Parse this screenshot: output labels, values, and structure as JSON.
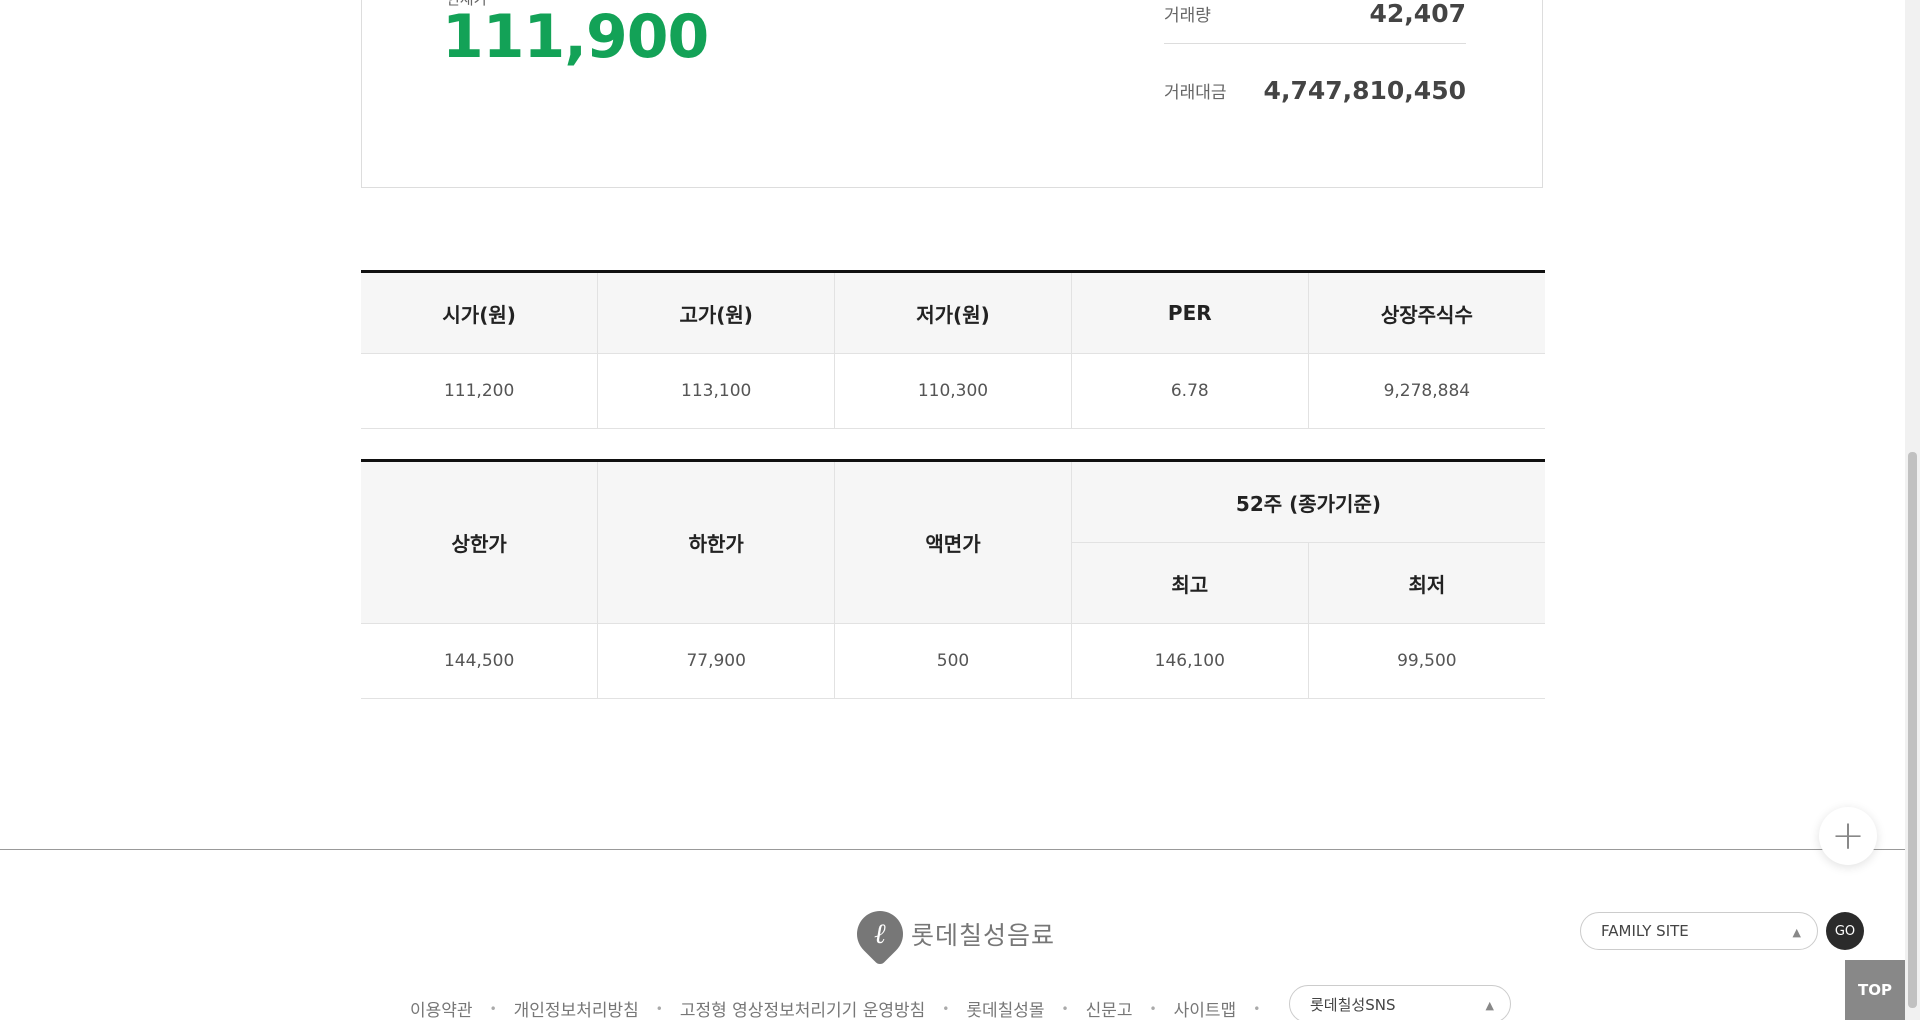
{
  "stock": {
    "current_label": "현재가",
    "current_price": "111,900",
    "volume_label": "거래량",
    "volume_value": "42,407",
    "amount_label": "거래대금",
    "amount_value": "4,747,810,450"
  },
  "table1": {
    "headers": [
      "시가(원)",
      "고가(원)",
      "저가(원)",
      "PER",
      "상장주식수"
    ],
    "values": [
      "111,200",
      "113,100",
      "110,300",
      "6.78",
      "9,278,884"
    ]
  },
  "table2": {
    "headers": {
      "upper": "상한가",
      "lower": "하한가",
      "par": "액면가",
      "week52": "52주 (종가기준)",
      "high": "최고",
      "low": "최저"
    },
    "values": [
      "144,500",
      "77,900",
      "500",
      "146,100",
      "99,500"
    ]
  },
  "footer": {
    "logo_text": "롯데칠성음료",
    "logo_mark": "ℓ",
    "family_site": "FAMILY SITE",
    "go": "GO",
    "links": [
      "이용약관",
      "개인정보처리방침",
      "고정형 영상정보처리기기 운영방침",
      "롯데칠성몰",
      "신문고",
      "사이트맵"
    ],
    "sns": "롯데칠성SNS",
    "top": "TOP",
    "plus": "+"
  }
}
